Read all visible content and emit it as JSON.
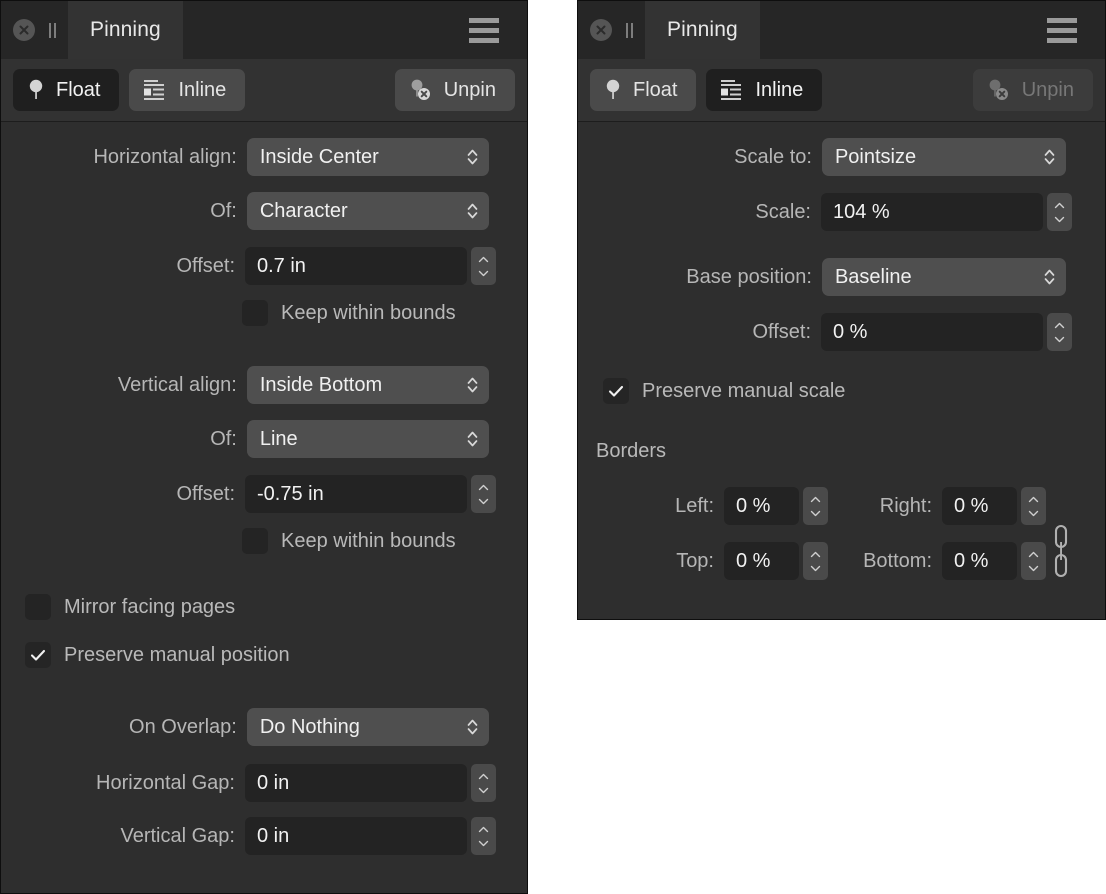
{
  "window": {
    "title": "Pinning",
    "close_icon": "close-circle-icon",
    "grip_icon": "drag-grip-icon",
    "menu_icon": "hamburger-menu-icon"
  },
  "colors": {
    "panel_bg": "#2e2e2e",
    "titlebar_bg": "#262626",
    "tab_bg": "#333333",
    "toolbar_bg": "#323232",
    "select_bg": "#4f4f4f",
    "field_bg": "#232323",
    "selected_btn_bg": "#1f1f1f",
    "text": "#e8e8e8",
    "label": "#b6b6b6",
    "disabled_text": "#777777"
  },
  "left_panel": {
    "toolbar": {
      "float_label": "Float",
      "float_icon": "pin-icon",
      "float_selected": true,
      "inline_label": "Inline",
      "inline_icon": "inline-text-icon",
      "inline_selected": false,
      "unpin_label": "Unpin",
      "unpin_icon": "unpin-icon",
      "unpin_disabled": false
    },
    "horizontal_align": {
      "label": "Horizontal align:",
      "value": "Inside Center"
    },
    "horizontal_of": {
      "label": "Of:",
      "value": "Character"
    },
    "horizontal_offset": {
      "label": "Offset:",
      "value": "0.7 in"
    },
    "horizontal_keep_bounds": {
      "label": "Keep within bounds",
      "checked": false
    },
    "vertical_align": {
      "label": "Vertical align:",
      "value": "Inside Bottom"
    },
    "vertical_of": {
      "label": "Of:",
      "value": "Line"
    },
    "vertical_offset": {
      "label": "Offset:",
      "value": "-0.75 in"
    },
    "vertical_keep_bounds": {
      "label": "Keep within bounds",
      "checked": false
    },
    "mirror_facing_pages": {
      "label": "Mirror facing pages",
      "checked": false
    },
    "preserve_manual_position": {
      "label": "Preserve manual position",
      "checked": true
    },
    "on_overlap": {
      "label": "On Overlap:",
      "value": "Do Nothing"
    },
    "horizontal_gap": {
      "label": "Horizontal Gap:",
      "value": "0 in"
    },
    "vertical_gap": {
      "label": "Vertical Gap:",
      "value": "0 in"
    }
  },
  "right_panel": {
    "toolbar": {
      "float_label": "Float",
      "float_icon": "pin-icon",
      "float_selected": false,
      "inline_label": "Inline",
      "inline_icon": "inline-text-icon",
      "inline_selected": true,
      "unpin_label": "Unpin",
      "unpin_icon": "unpin-icon",
      "unpin_disabled": true
    },
    "scale_to": {
      "label": "Scale to:",
      "value": "Pointsize"
    },
    "scale": {
      "label": "Scale:",
      "value": "104 %"
    },
    "base_position": {
      "label": "Base position:",
      "value": "Baseline"
    },
    "offset": {
      "label": "Offset:",
      "value": "0 %"
    },
    "preserve_manual_scale": {
      "label": "Preserve manual scale",
      "checked": true
    },
    "borders": {
      "title": "Borders",
      "link_icon": "chain-link-icon",
      "left": {
        "label": "Left:",
        "value": "0 %"
      },
      "right": {
        "label": "Right:",
        "value": "0 %"
      },
      "top": {
        "label": "Top:",
        "value": "0 %"
      },
      "bottom": {
        "label": "Bottom:",
        "value": "0 %"
      }
    }
  }
}
